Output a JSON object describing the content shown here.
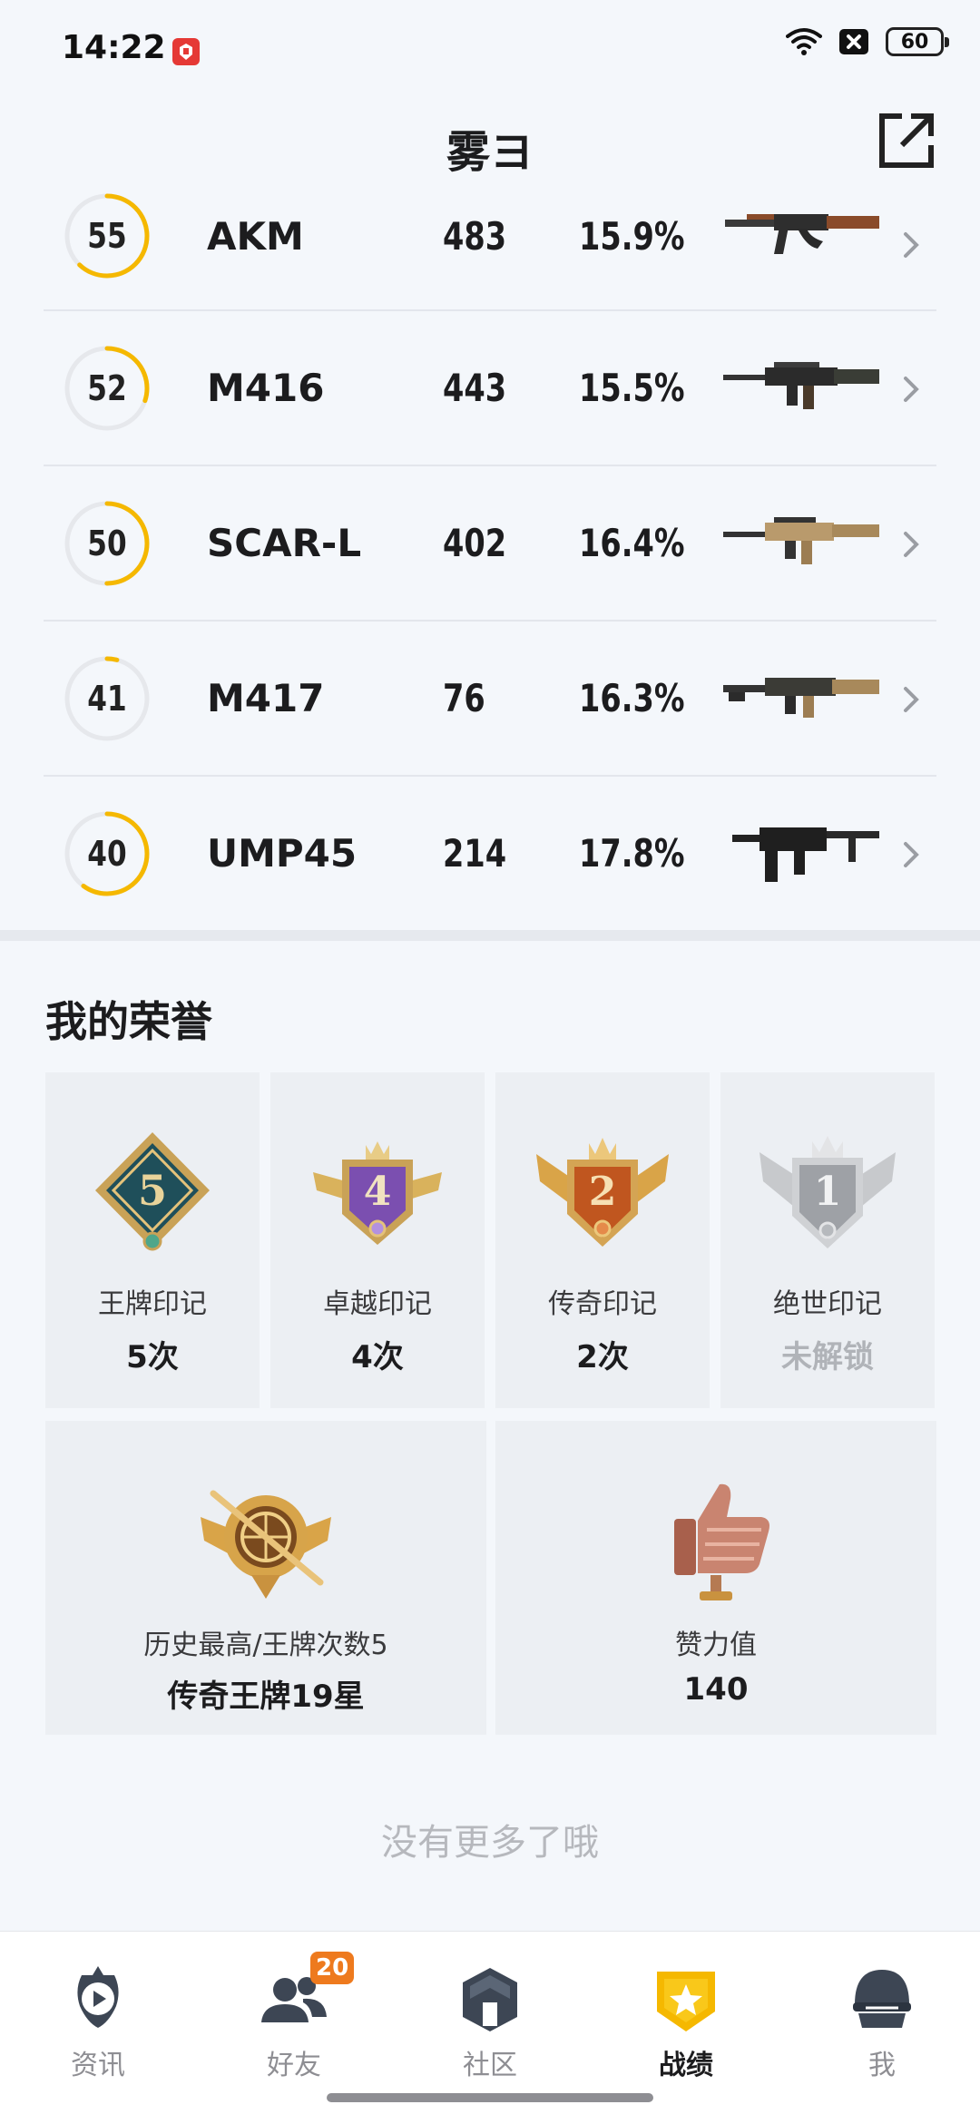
{
  "status_bar": {
    "time": "14:22",
    "battery": "60"
  },
  "header": {
    "title": "雾ヨ"
  },
  "weapons": [
    {
      "level": "55",
      "progress": 0.62,
      "name": "AKM",
      "kills": "483",
      "rate": "15.9%",
      "image": "akm-rifle-image"
    },
    {
      "level": "52",
      "progress": 0.3,
      "name": "M416",
      "kills": "443",
      "rate": "15.5%",
      "image": "m416-rifle-image"
    },
    {
      "level": "50",
      "progress": 0.5,
      "name": "SCAR-L",
      "kills": "402",
      "rate": "16.4%",
      "image": "scar-l-rifle-image"
    },
    {
      "level": "41",
      "progress": 0.04,
      "name": "M417",
      "kills": "76",
      "rate": "16.3%",
      "image": "m417-rifle-image"
    },
    {
      "level": "40",
      "progress": 0.6,
      "name": "UMP45",
      "kills": "214",
      "rate": "17.8%",
      "image": "ump45-smg-image"
    }
  ],
  "honors": {
    "title": "我的荣誉",
    "badges": [
      {
        "name": "王牌印记",
        "count": "5次",
        "number": "5",
        "icon": "ace-mark-icon"
      },
      {
        "name": "卓越印记",
        "count": "4次",
        "number": "4",
        "icon": "excellence-mark-icon"
      },
      {
        "name": "传奇印记",
        "count": "2次",
        "number": "2",
        "icon": "legend-mark-icon"
      },
      {
        "name": "绝世印记",
        "count": "未解锁",
        "number": "1",
        "icon": "peerless-mark-icon"
      }
    ],
    "highest": {
      "label": "历史最高/王牌次数5",
      "value": "传奇王牌19星",
      "icon": "legend-ace-emblem-icon"
    },
    "likes": {
      "label": "赞力值",
      "value": "140",
      "icon": "thumbs-up-trophy-icon"
    }
  },
  "footer_note": "没有更多了哦",
  "tab_bar": {
    "items": [
      {
        "label": "资讯",
        "icon": "news-icon"
      },
      {
        "label": "好友",
        "icon": "friends-icon",
        "badge": "20"
      },
      {
        "label": "社区",
        "icon": "community-icon"
      },
      {
        "label": "战绩",
        "icon": "record-icon",
        "active": true
      },
      {
        "label": "我",
        "icon": "helmet-icon"
      }
    ]
  },
  "colors": {
    "accent": "#f5b800",
    "ring_track": "#e6e8ec",
    "tab_badge": "#ee7a1e",
    "background": "#f4f7fb"
  }
}
